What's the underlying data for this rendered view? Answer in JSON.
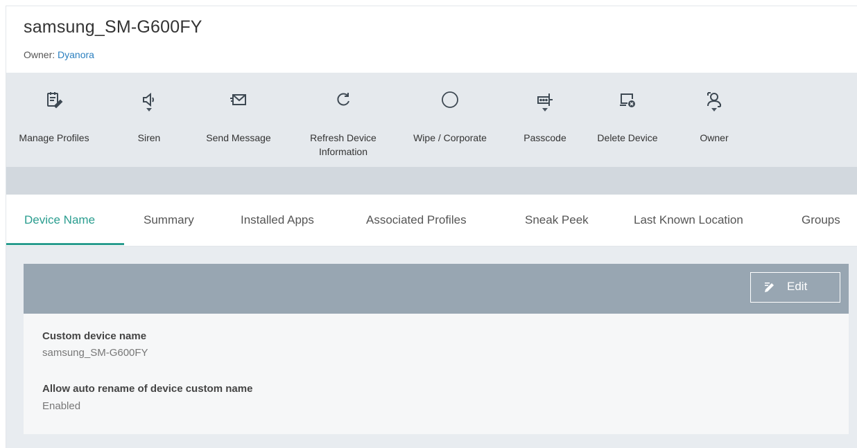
{
  "device": {
    "name": "samsung_SM-G600FY",
    "owner_label": "Owner:",
    "owner_name": "Dyanora"
  },
  "toolbar": {
    "items": [
      {
        "label": "Manage Profiles",
        "icon": "manage-profiles-icon",
        "dropdown": false
      },
      {
        "label": "Siren",
        "icon": "speaker-icon",
        "dropdown": true
      },
      {
        "label": "Send Message",
        "icon": "envelope-icon",
        "dropdown": false
      },
      {
        "label": "Refresh Device\nInformation",
        "icon": "refresh-icon",
        "dropdown": false
      },
      {
        "label": "Wipe / Corporate",
        "icon": "circle-icon",
        "dropdown": false
      },
      {
        "label": "Passcode",
        "icon": "passcode-icon",
        "dropdown": true
      },
      {
        "label": "Delete Device",
        "icon": "delete-device-icon",
        "dropdown": false
      },
      {
        "label": "Owner",
        "icon": "owner-icon",
        "dropdown": true
      }
    ]
  },
  "tabs": [
    {
      "label": "Device Name",
      "active": true
    },
    {
      "label": "Summary",
      "active": false
    },
    {
      "label": "Installed Apps",
      "active": false
    },
    {
      "label": "Associated Profiles",
      "active": false
    },
    {
      "label": "Sneak Peek",
      "active": false
    },
    {
      "label": "Last Known Location",
      "active": false
    },
    {
      "label": "Groups",
      "active": false
    }
  ],
  "panel": {
    "edit_label": "Edit",
    "fields": [
      {
        "label": "Custom device name",
        "value": "samsung_SM-G600FY"
      },
      {
        "label": "Allow auto rename of device custom name",
        "value": "Enabled"
      }
    ]
  },
  "colors": {
    "accent": "#2a9d8f",
    "link": "#2a7fbf",
    "toolbar_bg": "#e5e9ed",
    "panel_header": "#98a6b2"
  }
}
